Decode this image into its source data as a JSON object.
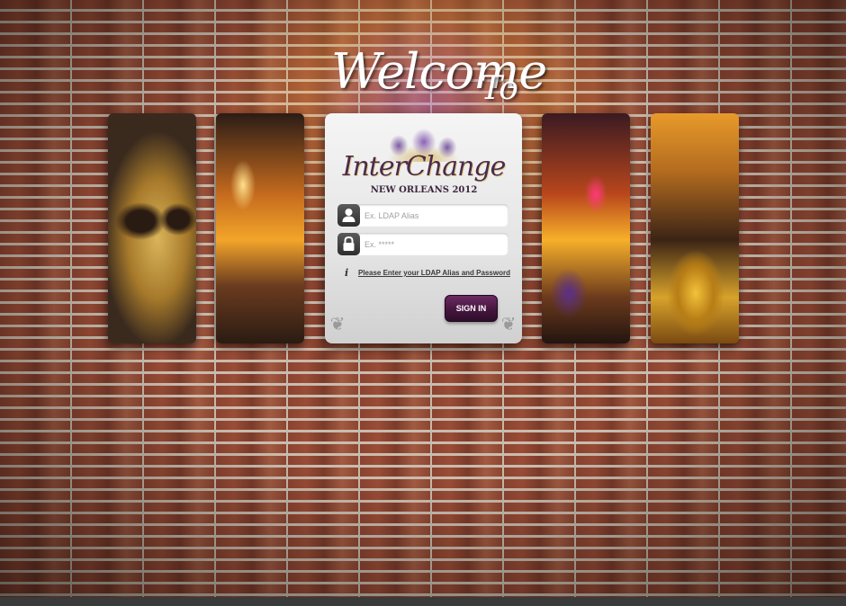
{
  "header": {
    "welcome_word": "Welcome",
    "to_word": "To"
  },
  "logo": {
    "title": "InterChange",
    "subtitle": "NEW ORLEANS 2012"
  },
  "login": {
    "username_placeholder": "Ex. LDAP Alias",
    "password_placeholder": "Ex. *****",
    "info_glyph": "i",
    "hint_text": "Please Enter your LDAP Alias and Password",
    "signin_label": "SIGN IN"
  },
  "icons": {
    "username": "user-icon",
    "password": "lock-icon",
    "hint": "info-icon"
  },
  "colors": {
    "signin_button": "#46163f",
    "logo_text": "#4a2b4f",
    "brick": "#8a4330"
  },
  "photos": [
    "mask-photo",
    "street-photo-left",
    "street-photo-right",
    "saxophone-photo"
  ]
}
